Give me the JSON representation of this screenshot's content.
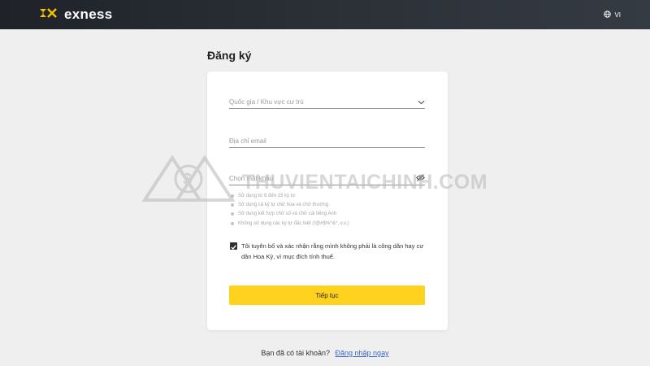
{
  "header": {
    "brand": "exness",
    "language": "VI",
    "icons": {
      "logo": "exness-logo-icon",
      "language": "globe-icon"
    },
    "colors": {
      "brand_accent": "#f5c400",
      "bar": "#2a2f36"
    }
  },
  "page": {
    "title": "Đăng ký"
  },
  "form": {
    "country": {
      "placeholder": "Quốc gia / Khu vực cư trú",
      "icon": "chevron-down-icon"
    },
    "email": {
      "placeholder": "Địa chỉ email"
    },
    "password": {
      "placeholder": "Chọn mật khẩu",
      "icon": "eye-off-icon"
    },
    "password_rules": [
      "Sử dụng từ 8 đến 15 ký tự",
      "Sử dụng cả ký tự chữ hoa và chữ thường",
      "Sử dụng kết hợp chữ số và chữ cái tiếng Anh",
      "Không sử dụng các ký tự đặc biệt (!@#$%^&*, v.v.)"
    ],
    "consent": {
      "checked": true,
      "text": "Tôi tuyên bố và xác nhận rằng mình không phải là công dân hay cư dân Hoa Kỳ, vì mục đích tính thuế."
    },
    "submit_label": "Tiếp tục",
    "submit_color": "#ffd21f"
  },
  "footer": {
    "prompt": "Bạn đã có tài khoản?",
    "login_link": "Đăng nhập ngay"
  },
  "watermark": {
    "text": "THUVIENTAICHINH.COM"
  }
}
